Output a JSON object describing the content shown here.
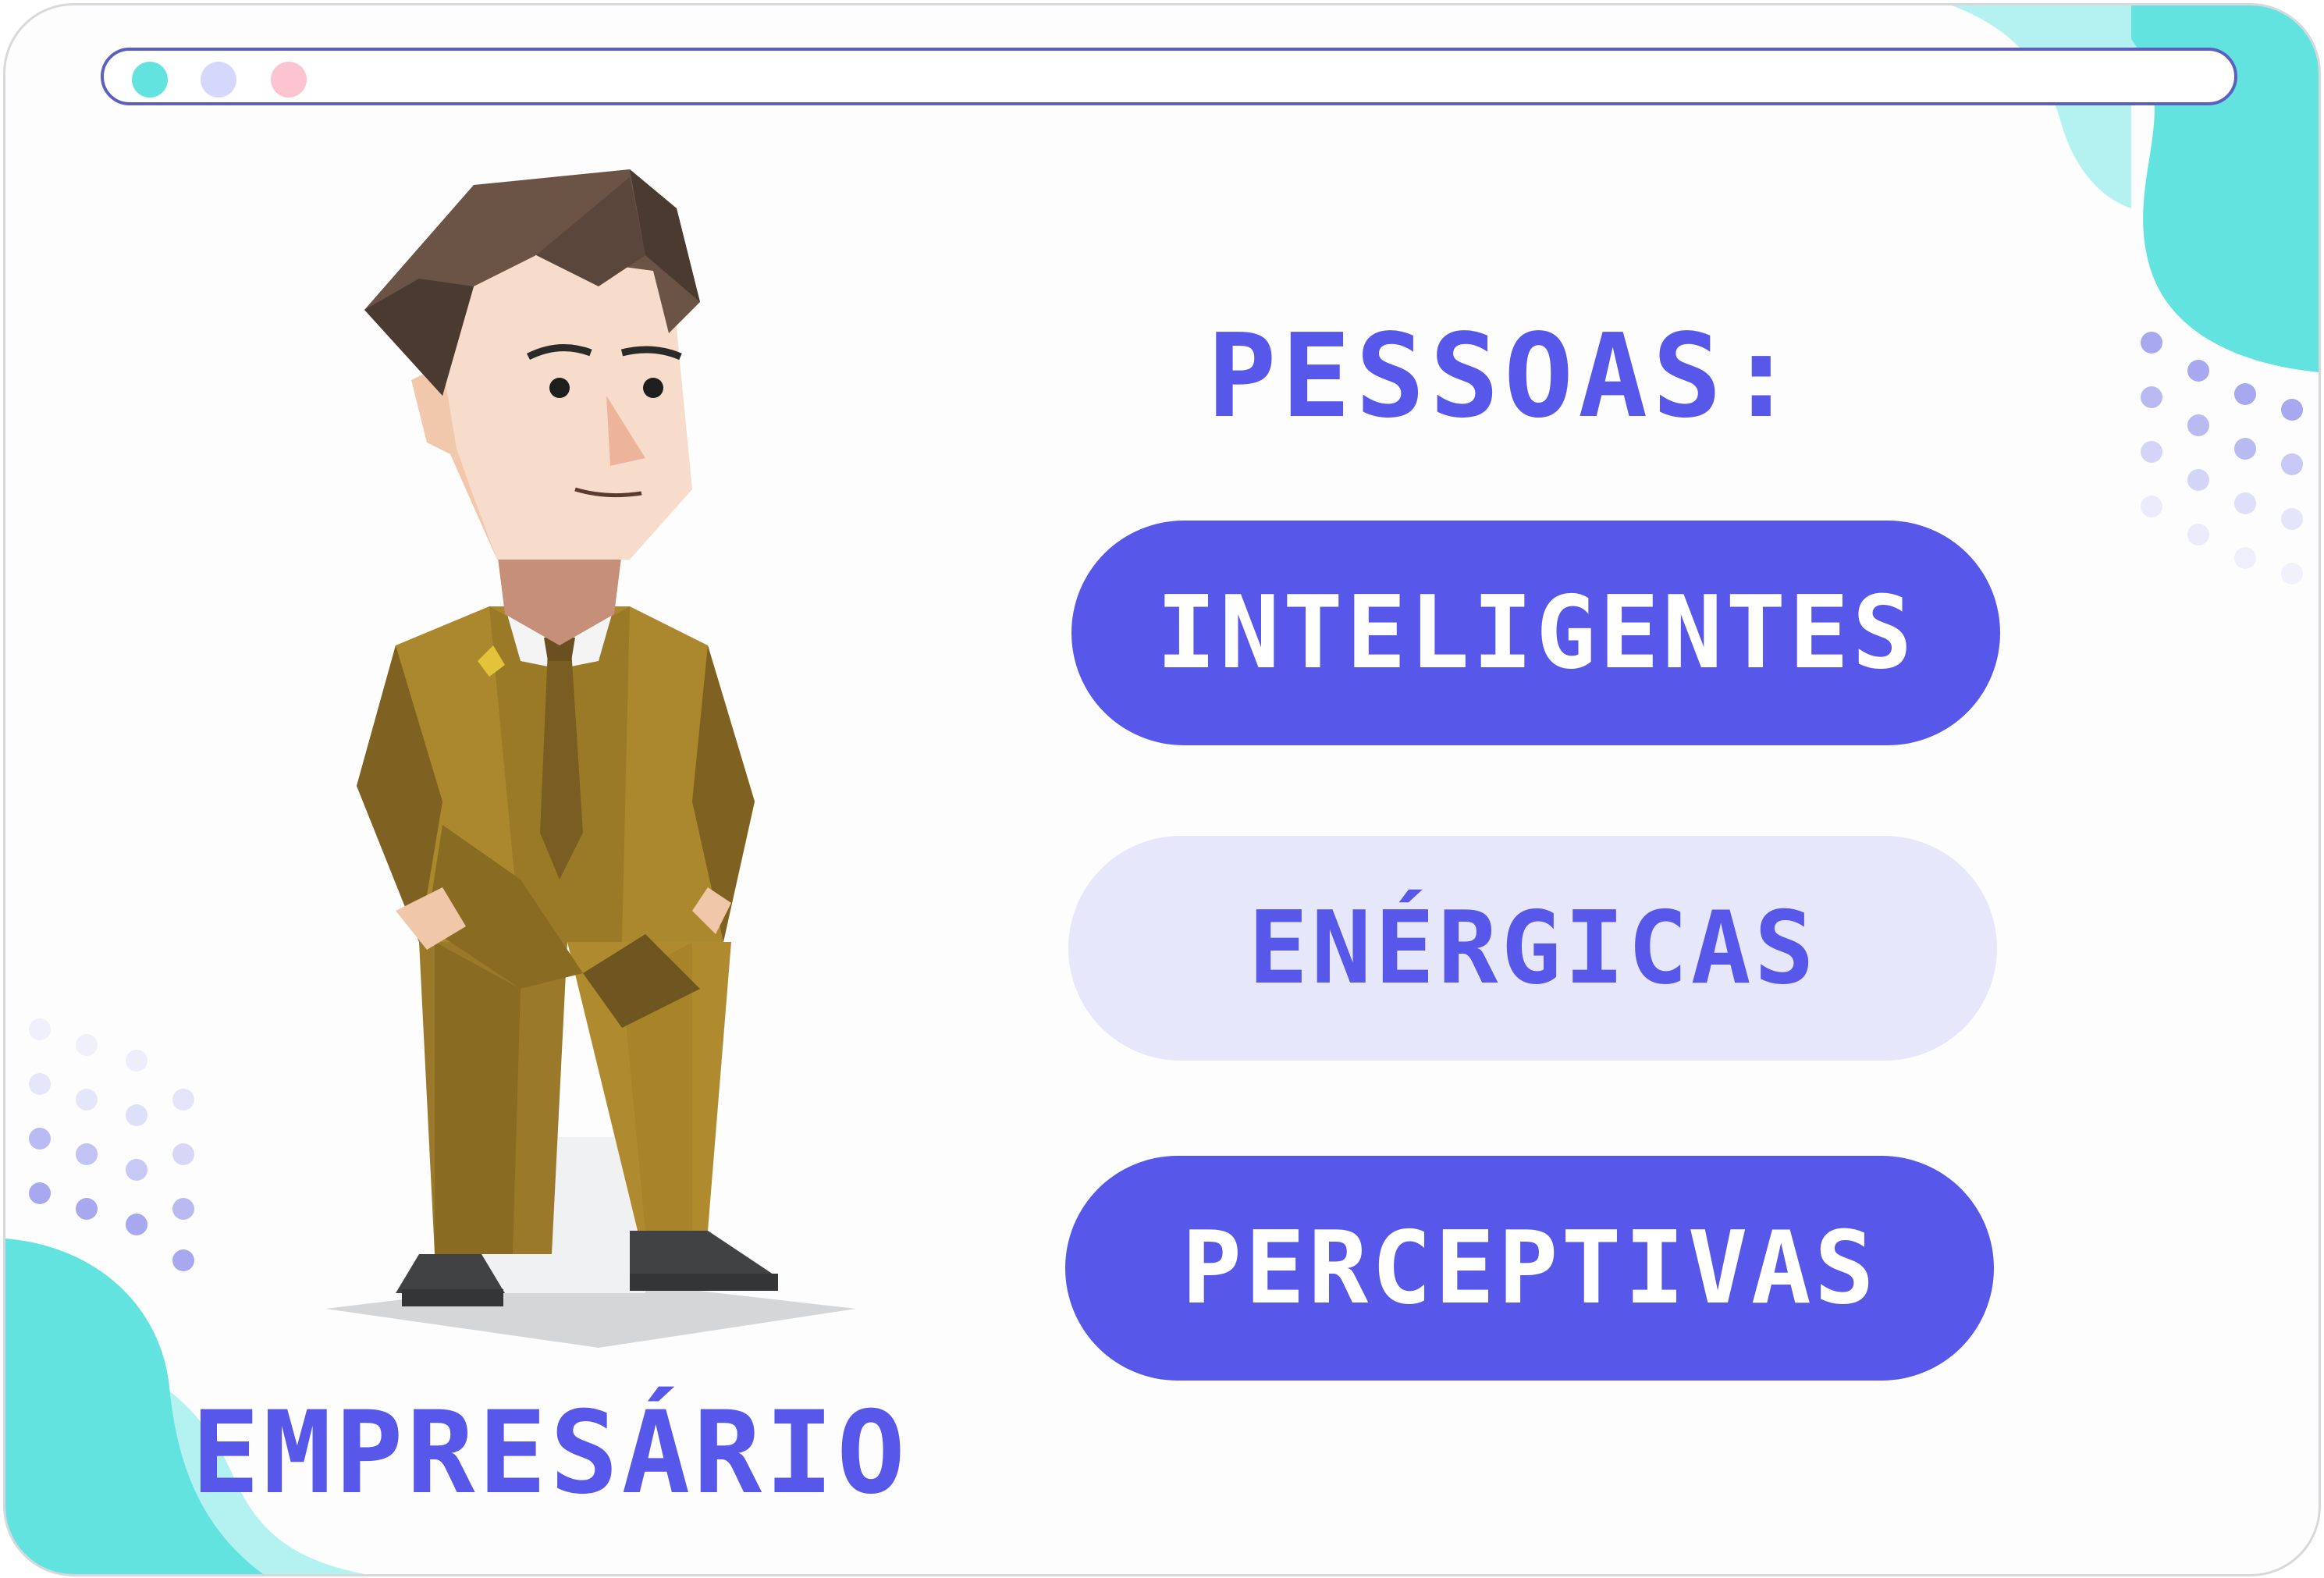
{
  "browser": {
    "window_dots": [
      {
        "name": "dot-teal",
        "color": "#62e3e0"
      },
      {
        "name": "dot-lavender",
        "color": "#d6d8fb"
      },
      {
        "name": "dot-pink",
        "color": "#fcc4d0"
      }
    ]
  },
  "heading": "PESSOAS:",
  "traits": [
    {
      "label": "INTELIGENTES",
      "style": "primary"
    },
    {
      "label": "ENÉRGICAS",
      "style": "secondary"
    },
    {
      "label": "PERCEPTIVAS",
      "style": "primary"
    }
  ],
  "character": {
    "icon": "businessman-illustration",
    "caption": "EMPRESÁRIO"
  },
  "colors": {
    "accent": "#5757ea",
    "accent_light": "#e6e7fb",
    "teal": "#62e3e0",
    "suit": "#a9852c"
  }
}
